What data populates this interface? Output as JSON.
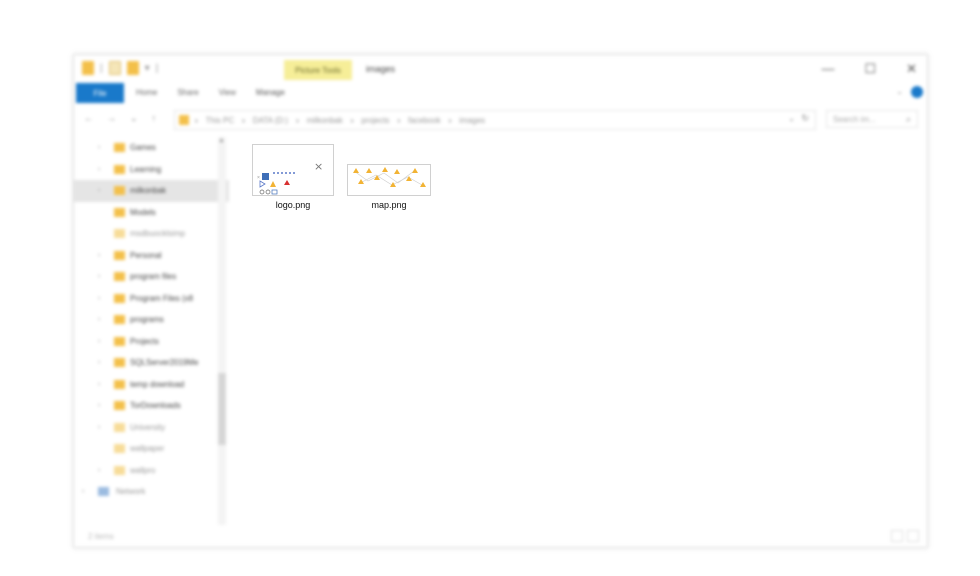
{
  "window": {
    "title": "images",
    "contextual_tab": "Picture Tools",
    "minimize_glyph": "—",
    "maximize_glyph": "☐",
    "close_glyph": "✕"
  },
  "quick_access": {
    "pin_glyph": "▾"
  },
  "ribbon": {
    "file": "File",
    "tabs": [
      "Home",
      "Share",
      "View",
      "Manage"
    ],
    "collapse_glyph": "⌄"
  },
  "nav_buttons": {
    "back": "←",
    "forward": "→",
    "up_list": "⌄",
    "up": "↑"
  },
  "address": {
    "crumbs": [
      "This PC",
      "DATA (D:)",
      "milkonbak",
      "projects",
      "facebook",
      "images"
    ],
    "separator": "›",
    "dropdown": "⌄",
    "refresh": "↻"
  },
  "search": {
    "placeholder": "Search im...",
    "icon": "⌕"
  },
  "nav_pane": {
    "items": [
      {
        "label": "Games",
        "expander": "›"
      },
      {
        "label": "Learning",
        "expander": "›"
      },
      {
        "label": "milkonbak",
        "expander": "›"
      },
      {
        "label": "Models",
        "expander": ""
      },
      {
        "label": "msdbuocklsimp",
        "expander": ""
      },
      {
        "label": "Personal",
        "expander": "›"
      },
      {
        "label": "program files",
        "expander": "›"
      },
      {
        "label": "Program Files (x8",
        "expander": "›"
      },
      {
        "label": "programs",
        "expander": "›"
      },
      {
        "label": "Projects",
        "expander": "›"
      },
      {
        "label": "SQLServer2019Me",
        "expander": "›"
      },
      {
        "label": "temp download",
        "expander": "›"
      },
      {
        "label": "TorDownloads",
        "expander": "›"
      },
      {
        "label": "University",
        "expander": "›"
      },
      {
        "label": "wallpaper",
        "expander": ""
      },
      {
        "label": "wallpro",
        "expander": "›"
      },
      {
        "label": "Network",
        "expander": "›"
      }
    ]
  },
  "files": [
    {
      "name": "logo.png",
      "close_glyph": "×"
    },
    {
      "name": "map.png"
    }
  ],
  "status": {
    "text": "2 items"
  }
}
